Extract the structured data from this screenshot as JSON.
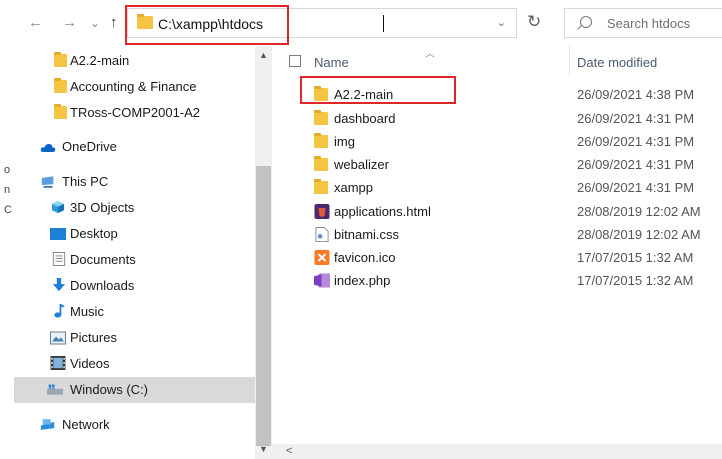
{
  "address": {
    "path": "C:\\xampp\\htdocs",
    "back_glyph": "←",
    "forward_glyph": "→",
    "recent_glyph": "⌄",
    "up_glyph": "↑",
    "dropdown_glyph": "⌄",
    "refresh_glyph": "↻"
  },
  "search": {
    "placeholder": "Search htdocs"
  },
  "background_window_chars": [
    "o",
    "n",
    "C"
  ],
  "nav": {
    "items": [
      {
        "label": "A2.2-main",
        "icon": "folder-icon"
      },
      {
        "label": "Accounting & Finance",
        "icon": "folder-icon"
      },
      {
        "label": "TRoss-COMP2001-A2",
        "icon": "folder-icon"
      },
      {
        "label": "OneDrive",
        "icon": "cloud-icon"
      },
      {
        "label": "This PC",
        "icon": "computer-icon"
      },
      {
        "label": "3D Objects",
        "icon": "cube-icon"
      },
      {
        "label": "Desktop",
        "icon": "desktop-icon"
      },
      {
        "label": "Documents",
        "icon": "document-icon"
      },
      {
        "label": "Downloads",
        "icon": "download-icon"
      },
      {
        "label": "Music",
        "icon": "music-icon"
      },
      {
        "label": "Pictures",
        "icon": "pictures-icon"
      },
      {
        "label": "Videos",
        "icon": "video-icon"
      },
      {
        "label": "Windows (C:)",
        "icon": "drive-icon"
      },
      {
        "label": "Network",
        "icon": "network-icon"
      }
    ]
  },
  "list": {
    "columns": {
      "name": "Name",
      "date": "Date modified"
    },
    "files": [
      {
        "name": "A2.2-main",
        "date": "26/09/2021 4:38 PM",
        "icon": "folder-icon"
      },
      {
        "name": "dashboard",
        "date": "26/09/2021 4:31 PM",
        "icon": "folder-icon"
      },
      {
        "name": "img",
        "date": "26/09/2021 4:31 PM",
        "icon": "folder-icon"
      },
      {
        "name": "webalizer",
        "date": "26/09/2021 4:31 PM",
        "icon": "folder-icon"
      },
      {
        "name": "xampp",
        "date": "26/09/2021 4:31 PM",
        "icon": "folder-icon"
      },
      {
        "name": "applications.html",
        "date": "28/08/2019 12:02 AM",
        "icon": "html-file-icon"
      },
      {
        "name": "bitnami.css",
        "date": "28/08/2019 12:02 AM",
        "icon": "css-file-icon"
      },
      {
        "name": "favicon.ico",
        "date": "17/07/2015 1:32 AM",
        "icon": "xampp-icon"
      },
      {
        "name": "index.php",
        "date": "17/07/2015 1:32 AM",
        "icon": "php-file-icon"
      }
    ]
  },
  "colors": {
    "highlight": "#e0252b",
    "folder": "#f4c542",
    "selection": "#d9d9d9"
  }
}
